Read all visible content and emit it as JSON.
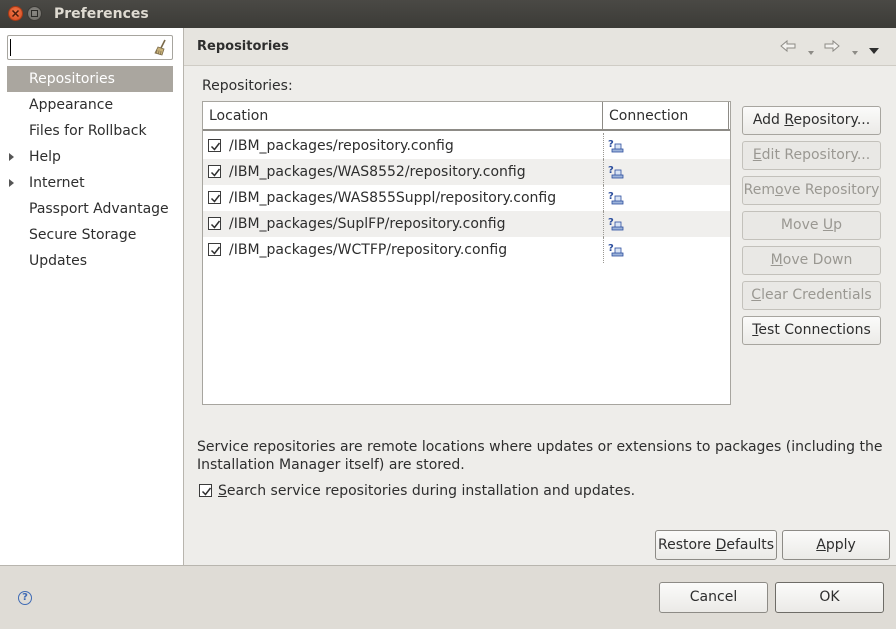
{
  "window": {
    "title": "Preferences"
  },
  "filter": {
    "value": ""
  },
  "tree": [
    {
      "label": "Repositories",
      "selected": true,
      "expandable": false
    },
    {
      "label": "Appearance",
      "selected": false,
      "expandable": false
    },
    {
      "label": "Files for Rollback",
      "selected": false,
      "expandable": false
    },
    {
      "label": "Help",
      "selected": false,
      "expandable": true
    },
    {
      "label": "Internet",
      "selected": false,
      "expandable": true
    },
    {
      "label": "Passport Advantage",
      "selected": false,
      "expandable": false
    },
    {
      "label": "Secure Storage",
      "selected": false,
      "expandable": false
    },
    {
      "label": "Updates",
      "selected": false,
      "expandable": false
    }
  ],
  "page": {
    "title": "Repositories",
    "repositories_label": "Repositories:",
    "columns": {
      "location": "Location",
      "connection": "Connection"
    },
    "rows": [
      {
        "location": "/IBM_packages/repository.config",
        "checked": true
      },
      {
        "location": "/IBM_packages/WAS8552/repository.config",
        "checked": true
      },
      {
        "location": "/IBM_packages/WAS855Suppl/repository.config",
        "checked": true
      },
      {
        "location": "/IBM_packages/SuplFP/repository.config",
        "checked": true
      },
      {
        "location": "/IBM_packages/WCTFP/repository.config",
        "checked": true
      }
    ],
    "buttons": {
      "add": {
        "pre": "Add ",
        "key": "R",
        "post": "epository..."
      },
      "edit": {
        "pre": "",
        "key": "E",
        "post": "dit Repository..."
      },
      "remove": {
        "pre": "Rem",
        "key": "o",
        "post": "ve Repository"
      },
      "move_up": {
        "pre": "Move ",
        "key": "U",
        "post": "p"
      },
      "move_down": {
        "pre": "",
        "key": "M",
        "post": "ove Down"
      },
      "clear": {
        "pre": "",
        "key": "C",
        "post": "lear Credentials"
      },
      "test": {
        "pre": "",
        "key": "T",
        "post": "est Connections"
      }
    },
    "description": "Service repositories are remote locations where updates or extensions to packages (including the Installation Manager itself) are stored.",
    "search_option": {
      "key": "S",
      "rest": "earch service repositories during installation and updates.",
      "checked": true
    },
    "restore_defaults": {
      "pre": "Restore ",
      "key": "D",
      "post": "efaults"
    },
    "apply": {
      "pre": "",
      "key": "A",
      "post": "pply"
    }
  },
  "footer": {
    "cancel": "Cancel",
    "ok": "OK"
  }
}
